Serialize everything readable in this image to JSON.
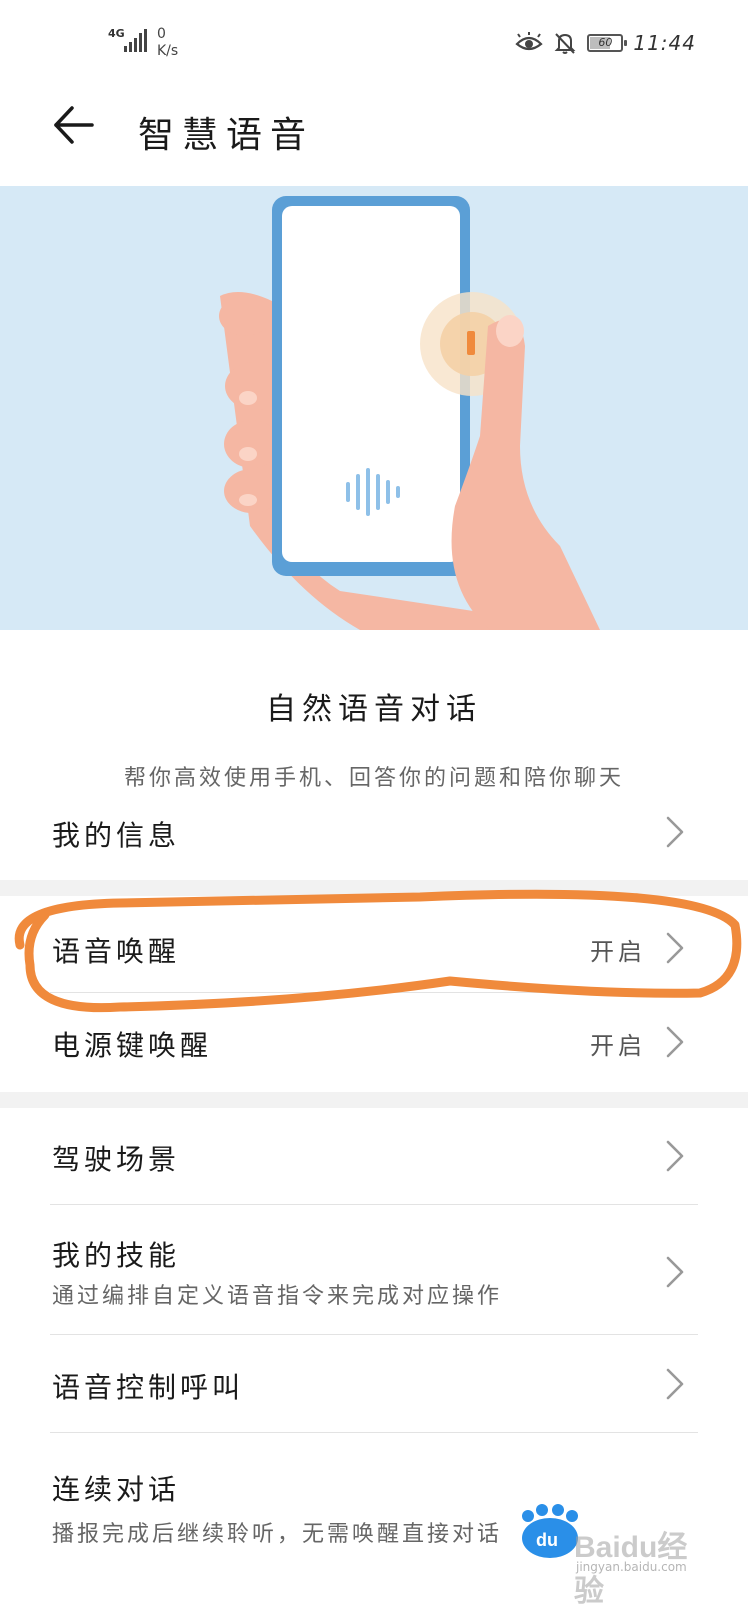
{
  "status_bar": {
    "network": "4G",
    "speed_value": "0",
    "speed_unit": "K/s",
    "battery": "60",
    "time": "11:44"
  },
  "header": {
    "title": "智慧语音"
  },
  "feature": {
    "title": "自然语音对话",
    "subtitle": "帮你高效使用手机、回答你的问题和陪你聊天"
  },
  "settings": {
    "my_info": {
      "label": "我的信息"
    },
    "voice_wakeup": {
      "label": "语音唤醒",
      "value": "开启"
    },
    "power_key_wakeup": {
      "label": "电源键唤醒",
      "value": "开启"
    },
    "driving_scene": {
      "label": "驾驶场景"
    },
    "my_skills": {
      "label": "我的技能",
      "description": "通过编排自定义语音指令来完成对应操作"
    },
    "voice_call_control": {
      "label": "语音控制呼叫"
    },
    "continuous_dialog": {
      "label": "连续对话",
      "description": "播报完成后继续聆听，无需唤醒直接对话"
    }
  },
  "colors": {
    "hero_bg": "#d6e9f6",
    "phone_frame": "#5b9fd6",
    "skin": "#f5b7a3",
    "annotation": "#f08a3c",
    "wave": "#8ec0e8"
  },
  "watermark": {
    "brand": "Baidu经验",
    "url": "jingyan.baidu.com"
  }
}
